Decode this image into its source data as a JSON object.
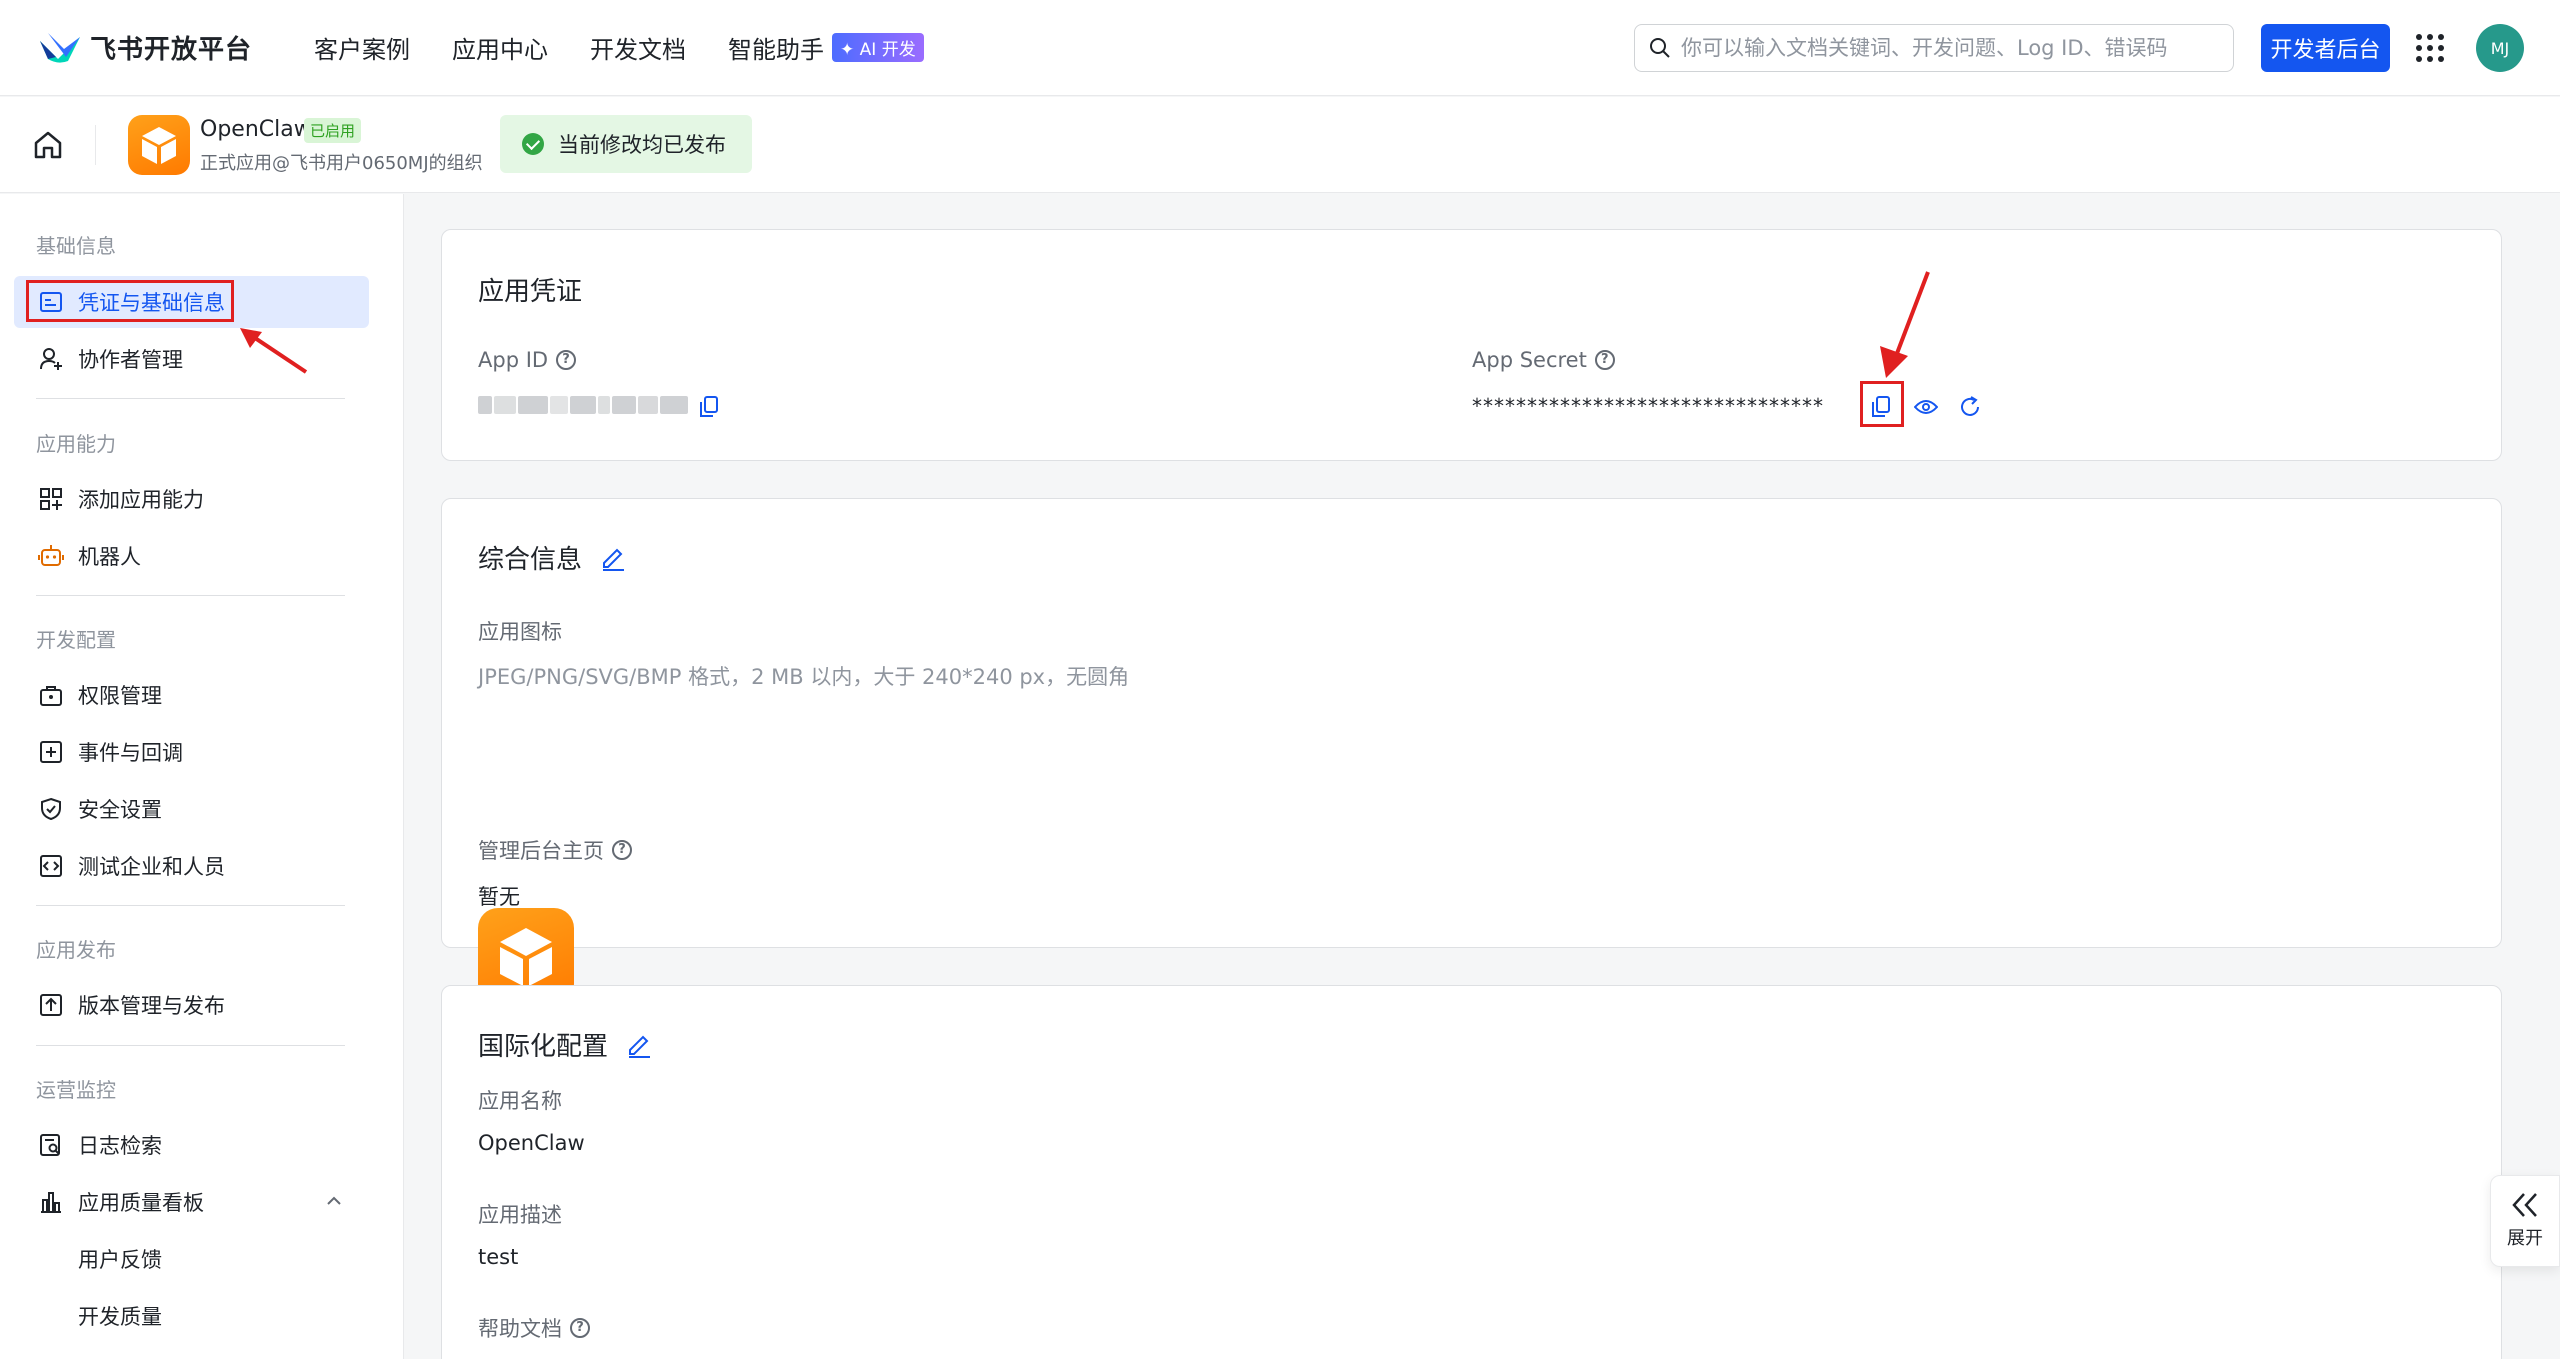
{
  "topnav": {
    "brand": "飞书开放平台",
    "links": [
      "客户案例",
      "应用中心",
      "开发文档",
      "智能助手"
    ],
    "ai_badge": "✦ AI 开发",
    "search_placeholder": "你可以输入文档关键词、开发问题、Log ID、错误码",
    "dev_console": "开发者后台",
    "avatar": "MJ"
  },
  "app_header": {
    "name": "OpenClaw",
    "status_tag": "已启用",
    "org": "正式应用@飞书用户0650MJ的组织",
    "publish_status": "当前修改均已发布"
  },
  "sidebar": {
    "sections": [
      {
        "title": "基础信息",
        "items": [
          {
            "label": "凭证与基础信息",
            "active": true
          },
          {
            "label": "协作者管理"
          }
        ]
      },
      {
        "title": "应用能力",
        "items": [
          {
            "label": "添加应用能力"
          },
          {
            "label": "机器人"
          }
        ]
      },
      {
        "title": "开发配置",
        "items": [
          {
            "label": "权限管理"
          },
          {
            "label": "事件与回调"
          },
          {
            "label": "安全设置"
          },
          {
            "label": "测试企业和人员"
          }
        ]
      },
      {
        "title": "应用发布",
        "items": [
          {
            "label": "版本管理与发布"
          }
        ]
      },
      {
        "title": "运营监控",
        "items": [
          {
            "label": "日志检索"
          },
          {
            "label": "应用质量看板"
          },
          {
            "label": "用户反馈"
          },
          {
            "label": "开发质量"
          }
        ]
      }
    ]
  },
  "credentials": {
    "title": "应用凭证",
    "app_id_label": "App ID",
    "app_secret_label": "App Secret",
    "app_secret_masked": "********************************"
  },
  "general": {
    "title": "综合信息",
    "icon_label": "应用图标",
    "icon_hint": "JPEG/PNG/SVG/BMP 格式，2 MB 以内，大于 240*240 px，无圆角",
    "admin_home_label": "管理后台主页",
    "admin_home_value": "暂无"
  },
  "i18n": {
    "title": "国际化配置",
    "name_label": "应用名称",
    "name_value": "OpenClaw",
    "desc_label": "应用描述",
    "desc_value": "test",
    "help_doc_label": "帮助文档"
  },
  "expand_label": "展开",
  "colors": {
    "primary": "#1456f0",
    "annotation": "#e02020",
    "app_orange": "#ff8a00"
  }
}
